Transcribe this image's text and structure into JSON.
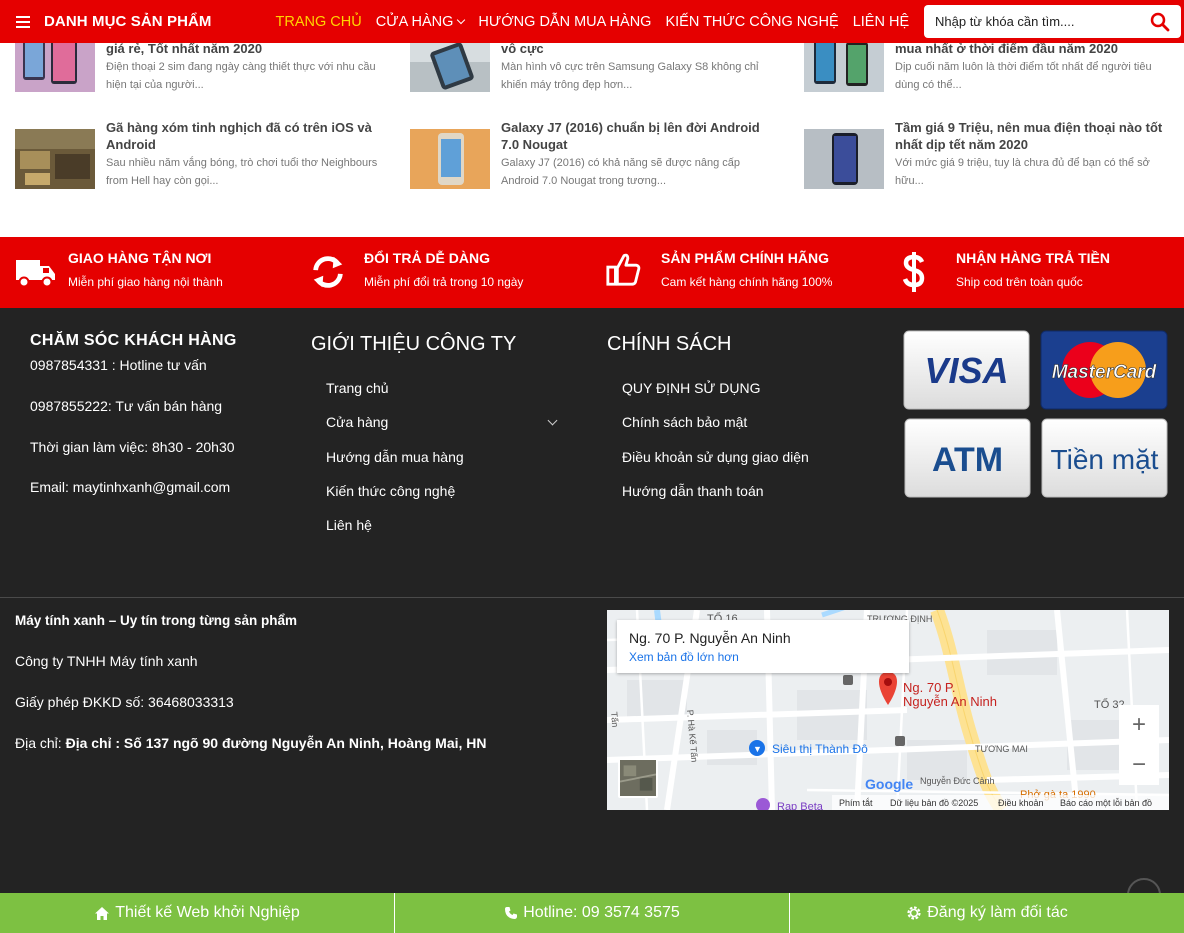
{
  "header": {
    "category_title": "DANH MỤC SẢN PHẨM",
    "nav": [
      "TRANG CHỦ",
      "CỬA HÀNG",
      "HƯỚNG DẪN MUA HÀNG",
      "KIẾN THỨC CÔNG NGHỆ",
      "LIÊN HỆ"
    ],
    "search_placeholder": "Nhập từ khóa cần tìm....",
    "accent_color": "#e50000",
    "active_color": "#ffd400"
  },
  "articles": [
    {
      "title": "giá rẻ, Tốt nhất năm 2020",
      "desc": "Điện thoại 2 sim đang ngày càng thiết thực với nhu cầu hiện tại của người..."
    },
    {
      "title": "vô cực",
      "desc": "Màn hình vô cực trên Samsung Galaxy S8 không chỉ khiến máy trông đẹp hơn..."
    },
    {
      "title": "mua nhất ở thời điểm đầu năm 2020",
      "desc": "Dịp cuối năm luôn là thời điểm tốt nhất để người tiêu dùng có thể..."
    },
    {
      "title": "Gã hàng xóm tinh nghịch đã có trên iOS và Android",
      "desc": "Sau nhiều năm vắng bóng, trò chơi tuổi thơ Neighbours from Hell hay còn gọi..."
    },
    {
      "title": "Galaxy J7 (2016) chuẩn bị lên đời Android 7.0 Nougat",
      "desc": "Galaxy J7 (2016) có khả năng sẽ được nâng cấp Android 7.0 Nougat trong tương..."
    },
    {
      "title": "Tầm giá 9 Triệu, nên mua điện thoại nào tốt nhất dịp tết năm 2020",
      "desc": "Với mức giá 9 triệu, tuy là chưa đủ để bạn có thể sở hữu..."
    }
  ],
  "features": [
    {
      "title": "GIAO HÀNG TẬN NƠI",
      "desc": "Miễn phí giao hàng nội thành",
      "icon": "truck-icon"
    },
    {
      "title": "ĐỔI TRẢ DỄ DÀNG",
      "desc": "Miễn phí đổi trả trong 10 ngày",
      "icon": "refresh-icon"
    },
    {
      "title": "SẢN PHẨM CHÍNH HÃNG",
      "desc": "Cam kết hàng chính hãng 100%",
      "icon": "thumbs-up-icon"
    },
    {
      "title": "NHẬN HÀNG TRẢ TIỀN",
      "desc": "Ship cod trên toàn quốc",
      "icon": "dollar-icon"
    }
  ],
  "footer": {
    "care": {
      "title": "CHĂM SÓC KHÁCH HÀNG",
      "lines": [
        "0987854331 : Hotline tư vấn",
        "0987855222: Tư vấn bán hàng",
        "Thời gian làm việc: 8h30 - 20h30",
        "Email: maytinhxanh@gmail.com"
      ]
    },
    "about": {
      "title": "GIỚI THIỆU CÔNG TY",
      "links": [
        "Trang chủ",
        "Cửa hàng",
        "Hướng dẫn mua hàng",
        "Kiến thức công nghệ",
        "Liên hệ"
      ]
    },
    "policy": {
      "title": "CHÍNH SÁCH",
      "links": [
        "QUY ĐỊNH SỬ DỤNG",
        "Chính sách bảo mật",
        "Điều khoản sử dụng giao diện",
        "Hướng dẫn thanh toán"
      ]
    },
    "payments": [
      "VISA",
      "MasterCard",
      "ATM",
      "Tiền mặt"
    ],
    "company": {
      "slogan": "Máy tính xanh – Uy tín trong từng sản phẩm",
      "name": "Công ty TNHH Máy tính xanh",
      "license": "Giấy phép ĐKKD số: 36468033313",
      "address_label": "Địa chỉ:",
      "address": "Địa chỉ : Số 137 ngõ 90 đường Nguyễn An Ninh, Hoàng Mai, HN"
    },
    "map": {
      "place": "Ng. 70 P. Nguyễn An Ninh",
      "bigger_map": "Xem bản đồ lớn hơn",
      "pin_label_1": "Ng. 70 P.",
      "pin_label_2": "Nguyễn An Ninh",
      "labels": [
        "TỔ 16",
        "TRƯƠNG ĐỊNH",
        "TỔ 32",
        "Siêu thị Thành Đô",
        "TƯƠNG MAI",
        "Nguyễn Đức Cảnh",
        "Phở gà ta 1990",
        "Rạp Beta",
        "P. Hà Kế Tấn",
        "Tấn"
      ],
      "logo": "Google",
      "attribution": [
        "Phím tắt",
        "Dữ liệu bản đồ ©2025",
        "Điều khoản",
        "Báo cáo một lỗi bản đồ"
      ]
    }
  },
  "bottom_bar": [
    "Thiết kế Web khởi Nghiệp",
    "Hotline: 09 3574 3575",
    "Đăng ký làm đối tác"
  ]
}
